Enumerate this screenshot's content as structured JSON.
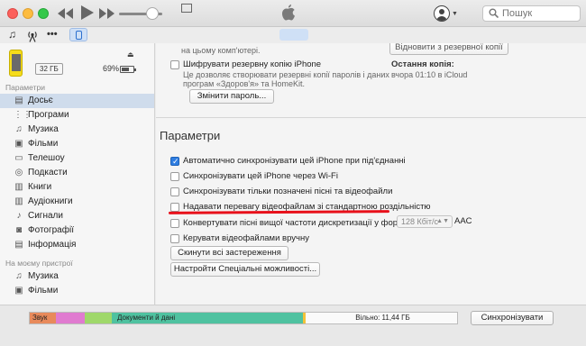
{
  "search": {
    "placeholder": "Пошук"
  },
  "device": {
    "capacity": "32 ГБ",
    "battery_pct": "69%",
    "battery_level": 0.69
  },
  "sidebar": {
    "settings_header": "Параметри",
    "items": [
      {
        "label": "Досьє",
        "icon": "summary-icon",
        "active": true
      },
      {
        "label": "Програми",
        "icon": "apps-icon"
      },
      {
        "label": "Музика",
        "icon": "music-icon"
      },
      {
        "label": "Фільми",
        "icon": "film-icon"
      },
      {
        "label": "Телешоу",
        "icon": "tv-icon"
      },
      {
        "label": "Подкасти",
        "icon": "podcast-icon"
      },
      {
        "label": "Книги",
        "icon": "book-icon"
      },
      {
        "label": "Аудіокниги",
        "icon": "audiobook-icon"
      },
      {
        "label": "Сигнали",
        "icon": "bell-icon"
      },
      {
        "label": "Фотографії",
        "icon": "camera-icon"
      },
      {
        "label": "Інформація",
        "icon": "info-icon"
      }
    ],
    "on_device_header": "На моєму пристрої",
    "device_items": [
      {
        "label": "Музика",
        "icon": "music-icon"
      },
      {
        "label": "Фільми",
        "icon": "film-icon"
      }
    ]
  },
  "backup": {
    "this_computer_tail": "на цьому комп'ютері.",
    "encrypt_label": "Шифрувати резервну копію iPhone",
    "encrypt_desc_1": "Це дозволяє створювати резервні копії паролів і даних",
    "encrypt_desc_2": "програм «Здоров'я» та HomeKit.",
    "change_password": "Змінити пароль...",
    "restore_button": "Відновити з резервної копії",
    "last_copies_label": "Остання копія:",
    "last_copies_value": "вчора 01:10 в iCloud"
  },
  "params": {
    "title": "Параметри",
    "opts": [
      {
        "label": "Автоматично синхронізувати цей iPhone при під'єднанні",
        "checked": true
      },
      {
        "label": "Синхронізувати цей iPhone через Wi-Fi",
        "checked": false
      },
      {
        "label": "Синхронізувати тільки позначені пісні та відеофайли",
        "checked": false
      },
      {
        "label": "Надавати перевагу відеофайлам зі стандартною роздільністю",
        "checked": false
      },
      {
        "label": "Конвертувати пісні вищої частоти дискретизації у формат",
        "checked": false
      },
      {
        "label": "Керувати відеофайлами вручну",
        "checked": false
      }
    ],
    "bitrate": "128 Кбіт/с",
    "codec": "AAC",
    "reset_warnings": "Скинути всі застереження",
    "accessibility": "Настройти Спеціальні можливості..."
  },
  "storage": {
    "segments": [
      {
        "label": "Звук",
        "color": "#e88a5b",
        "fraction": 0.062
      },
      {
        "label": "",
        "color": "#e07bd0",
        "fraction": 0.068
      },
      {
        "label": "",
        "color": "#9fd86a",
        "fraction": 0.063
      },
      {
        "label": "Документи й дані",
        "color": "#4fc2a0",
        "fraction": 0.448
      },
      {
        "label": "",
        "color": "#f2c23a",
        "fraction": 0.006
      }
    ],
    "free_label": "Вільно: 11,44 ГБ",
    "sync_button": "Синхронізувати"
  }
}
